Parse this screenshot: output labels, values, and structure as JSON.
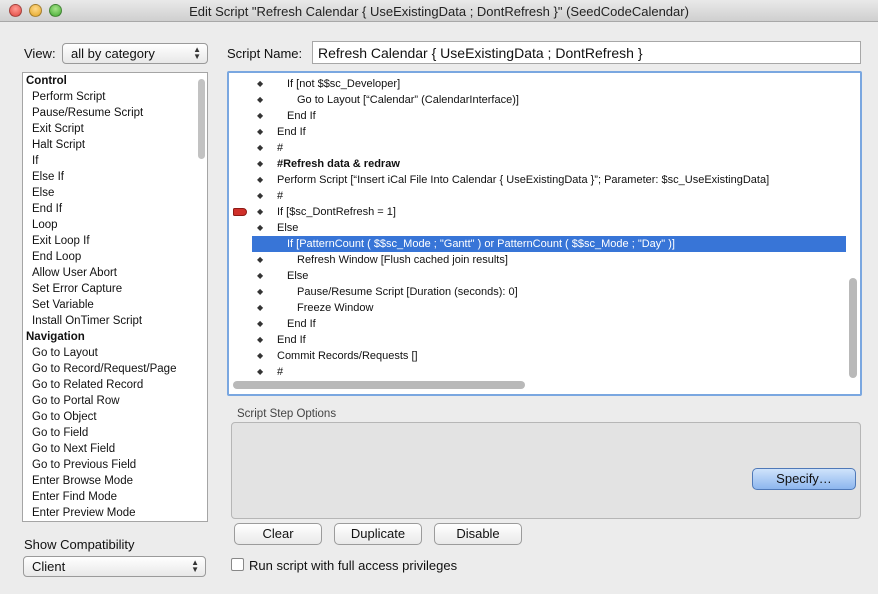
{
  "window": {
    "title": "Edit Script \"Refresh Calendar { UseExistingData ; DontRefresh }\" (SeedCodeCalendar)"
  },
  "view": {
    "label": "View:",
    "value": "all by category"
  },
  "steps_list": [
    {
      "label": "Control",
      "category": true
    },
    {
      "label": "Perform Script"
    },
    {
      "label": "Pause/Resume Script"
    },
    {
      "label": "Exit Script"
    },
    {
      "label": "Halt Script"
    },
    {
      "label": "If"
    },
    {
      "label": "Else If"
    },
    {
      "label": "Else"
    },
    {
      "label": "End If"
    },
    {
      "label": "Loop"
    },
    {
      "label": "Exit Loop If"
    },
    {
      "label": "End Loop"
    },
    {
      "label": "Allow User Abort"
    },
    {
      "label": "Set Error Capture"
    },
    {
      "label": "Set Variable"
    },
    {
      "label": "Install OnTimer Script"
    },
    {
      "label": "Navigation",
      "category": true
    },
    {
      "label": "Go to Layout"
    },
    {
      "label": "Go to Record/Request/Page"
    },
    {
      "label": "Go to Related Record"
    },
    {
      "label": "Go to Portal Row"
    },
    {
      "label": "Go to Object"
    },
    {
      "label": "Go to Field"
    },
    {
      "label": "Go to Next Field"
    },
    {
      "label": "Go to Previous Field"
    },
    {
      "label": "Enter Browse Mode"
    },
    {
      "label": "Enter Find Mode"
    },
    {
      "label": "Enter Preview Mode"
    }
  ],
  "script_name": {
    "label": "Script Name:",
    "value": "Refresh Calendar { UseExistingData ; DontRefresh }"
  },
  "script_lines": [
    {
      "text": "If [not $$sc_Developer]",
      "indent": 1
    },
    {
      "text": "Go to Layout [“Calendar” (CalendarInterface)]",
      "indent": 2
    },
    {
      "text": "End If",
      "indent": 1
    },
    {
      "text": "End If",
      "indent": 0
    },
    {
      "text": "#",
      "indent": 0
    },
    {
      "text": "#Refresh data & redraw",
      "indent": 0,
      "bold": true
    },
    {
      "text": "Perform Script [“Insert iCal File Into Calendar { UseExistingData }”; Parameter: $sc_UseExistingData]",
      "indent": 0
    },
    {
      "text": "#",
      "indent": 0
    },
    {
      "text": "If [$sc_DontRefresh = 1]",
      "indent": 0,
      "breakpoint": true
    },
    {
      "text": "Else",
      "indent": 0
    },
    {
      "text": "If [PatternCount ( $$sc_Mode ; \"Gantt\" ) or PatternCount ( $$sc_Mode ; \"Day\" )]",
      "indent": 1,
      "selected": true
    },
    {
      "text": "Refresh Window [Flush cached join results]",
      "indent": 2
    },
    {
      "text": "Else",
      "indent": 1
    },
    {
      "text": "Pause/Resume Script [Duration (seconds): 0]",
      "indent": 2
    },
    {
      "text": "Freeze Window",
      "indent": 2
    },
    {
      "text": "End If",
      "indent": 1
    },
    {
      "text": "End If",
      "indent": 0
    },
    {
      "text": "Commit Records/Requests []",
      "indent": 0
    },
    {
      "text": "#",
      "indent": 0
    }
  ],
  "options": {
    "label": "Script Step Options",
    "specify_label": "Specify…"
  },
  "buttons": {
    "clear": "Clear",
    "duplicate": "Duplicate",
    "disable": "Disable"
  },
  "compatibility": {
    "label": "Show Compatibility",
    "value": "Client"
  },
  "full_access": {
    "label": "Run script with full access privileges",
    "checked": false
  },
  "colors": {
    "selection": "#3875d7",
    "focus_ring": "#7aa7e0",
    "breakpoint": "#d0302a"
  }
}
